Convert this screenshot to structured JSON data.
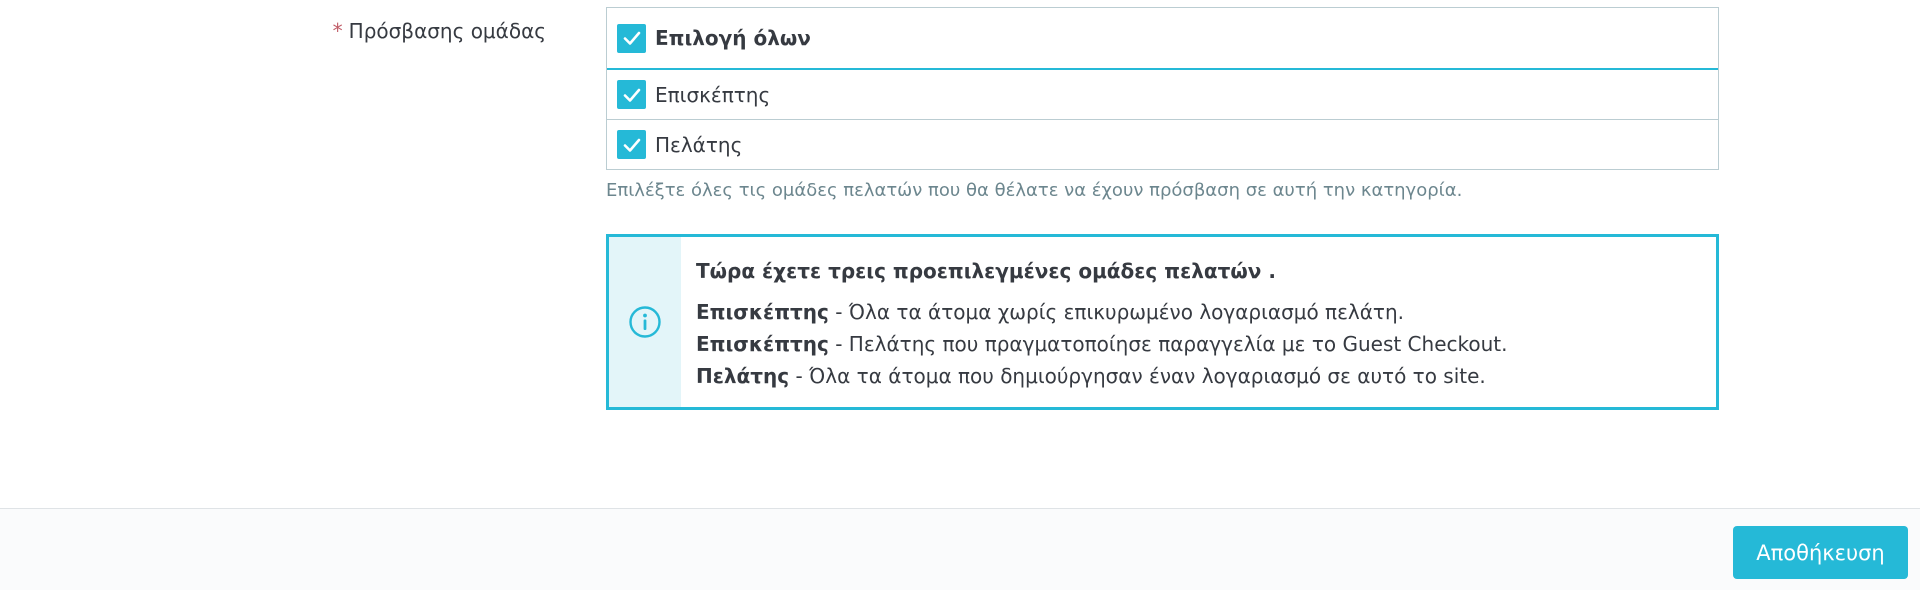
{
  "field": {
    "required_mark": "*",
    "label": "Πρόσβασης ομάδας"
  },
  "group_table": {
    "select_all_label": "Επιλογή όλων",
    "select_all_checked": true,
    "rows": [
      {
        "label": "Επισκέπτης",
        "checked": true
      },
      {
        "label": "Πελάτης",
        "checked": true
      }
    ]
  },
  "help_text": "Επιλέξτε όλες τις ομάδες πελατών που θα θέλατε να έχουν πρόσβαση σε αυτή την κατηγορία.",
  "info": {
    "icon": "info-circle-icon",
    "title": "Τώρα έχετε τρεις προεπιλεγμένες ομάδες πελατών .",
    "lines": [
      {
        "term": "Επισκέπτης",
        "desc": " - Όλα τα άτομα χωρίς επικυρωμένο λογαριασμό πελάτη."
      },
      {
        "term": "Επισκέπτης",
        "desc": " - Πελάτης που πραγματοποίησε παραγγελία με το Guest Checkout."
      },
      {
        "term": "Πελάτης",
        "desc": " - Όλα τα άτομα που δημιούργησαν έναν λογαριασμό σε αυτό το site."
      }
    ]
  },
  "footer": {
    "save_label": "Αποθήκευση"
  },
  "colors": {
    "accent": "#25b9d7",
    "required": "#c05c67",
    "info_strip": "#e3f5f9"
  }
}
